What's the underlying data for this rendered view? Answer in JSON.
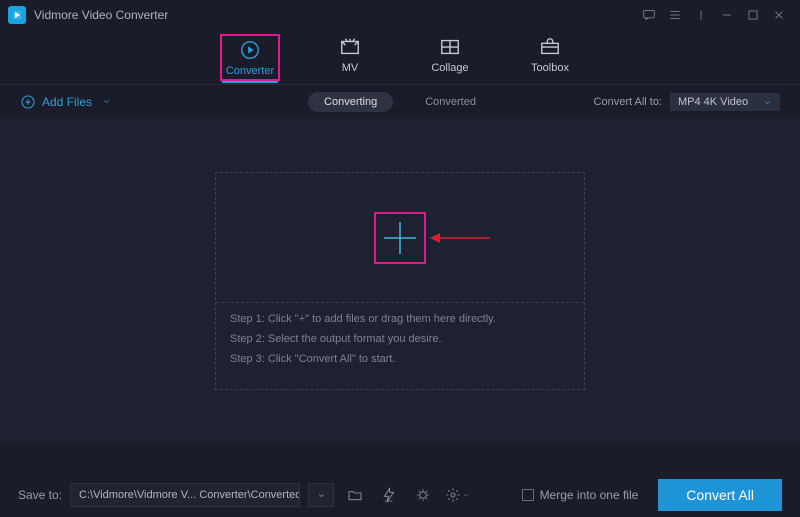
{
  "app": {
    "title": "Vidmore Video Converter"
  },
  "tabs": {
    "items": [
      {
        "label": "Converter"
      },
      {
        "label": "MV"
      },
      {
        "label": "Collage"
      },
      {
        "label": "Toolbox"
      }
    ]
  },
  "toolbar": {
    "add_files": "Add Files",
    "seg_converting": "Converting",
    "seg_converted": "Converted",
    "convert_all_to_label": "Convert All to:",
    "format_selected": "MP4 4K Video"
  },
  "dropzone": {
    "step1": "Step 1: Click \"+\" to add files or drag them here directly.",
    "step2": "Step 2: Select the output format you desire.",
    "step3": "Step 3: Click \"Convert All\" to start."
  },
  "bottom": {
    "save_to_label": "Save to:",
    "path": "C:\\Vidmore\\Vidmore V... Converter\\Converted",
    "merge_label": "Merge into one file",
    "convert_all_btn": "Convert All"
  }
}
